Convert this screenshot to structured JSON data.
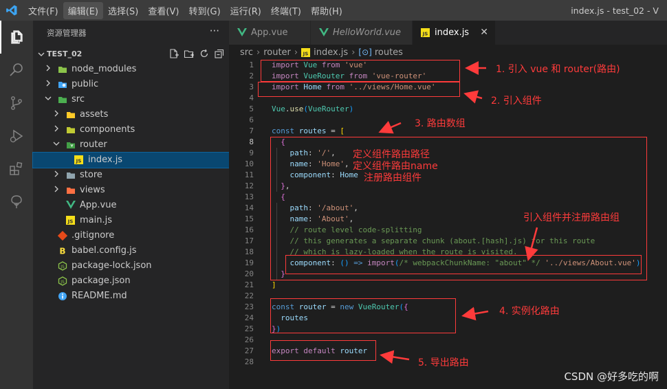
{
  "menu": [
    "文件(F)",
    "编辑(E)",
    "选择(S)",
    "查看(V)",
    "转到(G)",
    "运行(R)",
    "终端(T)",
    "帮助(H)"
  ],
  "window_title": "index.js - test_02 - V",
  "explorer": {
    "header": "资源管理器",
    "project": "TEST_02",
    "items": [
      {
        "label": "node_modules",
        "icon": "folder-node-icon",
        "expanded": false
      },
      {
        "label": "public",
        "icon": "folder-public-icon",
        "expanded": false
      },
      {
        "label": "src",
        "icon": "folder-src-icon",
        "expanded": true
      },
      {
        "label": "assets",
        "icon": "folder-assets-icon",
        "expanded": false
      },
      {
        "label": "components",
        "icon": "folder-components-icon",
        "expanded": false
      },
      {
        "label": "router",
        "icon": "folder-router-icon",
        "expanded": true
      },
      {
        "label": "index.js",
        "icon": "js-file-icon"
      },
      {
        "label": "store",
        "icon": "folder-store-icon",
        "expanded": false
      },
      {
        "label": "views",
        "icon": "folder-views-icon",
        "expanded": false
      },
      {
        "label": "App.vue",
        "icon": "vue-file-icon"
      },
      {
        "label": "main.js",
        "icon": "js-file-icon"
      },
      {
        "label": ".gitignore",
        "icon": "git-file-icon"
      },
      {
        "label": "babel.config.js",
        "icon": "babel-file-icon"
      },
      {
        "label": "package-lock.json",
        "icon": "npm-file-icon"
      },
      {
        "label": "package.json",
        "icon": "npm-file-icon"
      },
      {
        "label": "README.md",
        "icon": "info-file-icon"
      }
    ]
  },
  "tabs": [
    {
      "label": "App.vue",
      "icon": "vue-file-icon"
    },
    {
      "label": "HelloWorld.vue",
      "icon": "vue-file-icon"
    },
    {
      "label": "index.js",
      "icon": "js-file-icon"
    }
  ],
  "tab_close": "✕",
  "breadcrumb": {
    "part1": "src",
    "part2": "router",
    "part3": "index.js",
    "part4": "routes"
  },
  "code_lines": [
    "import Vue from 'vue'",
    "import VueRouter from 'vue-router'",
    "import Home from '../views/Home.vue'",
    "",
    "Vue.use(VueRouter)",
    "",
    "const routes = [",
    "  {",
    "    path: '/',",
    "    name: 'Home',",
    "    component: Home",
    "  },",
    "  {",
    "    path: '/about',",
    "    name: 'About',",
    "    // route level code-splitting",
    "    // this generates a separate chunk (about.[hash].js) for this route",
    "    // which is lazy-loaded when the route is visited.",
    "    component: () => import(/* webpackChunkName: \"about\" */ '../views/About.vue')",
    "  }",
    "]",
    "",
    "const router = new VueRouter({",
    "  routes",
    "})",
    "",
    "export default router",
    ""
  ],
  "annotations": {
    "a1": "1. 引入 vue 和 router(路由)",
    "a2": "2. 引入组件",
    "a3": "3. 路由数组",
    "a4": "定义组件路由路径",
    "a5": "定义组件路由name",
    "a6": "注册路由组件",
    "a7": "引入组件并注册路由组",
    "a8": "4. 实例化路由",
    "a9": "5. 导出路由"
  },
  "watermark": "CSDN @好多吃的啊",
  "colors": {
    "accent_red": "#ff3b3b",
    "keyword": "#569cd6",
    "string": "#ce9178",
    "comment": "#6a9955",
    "selection": "#094771"
  }
}
